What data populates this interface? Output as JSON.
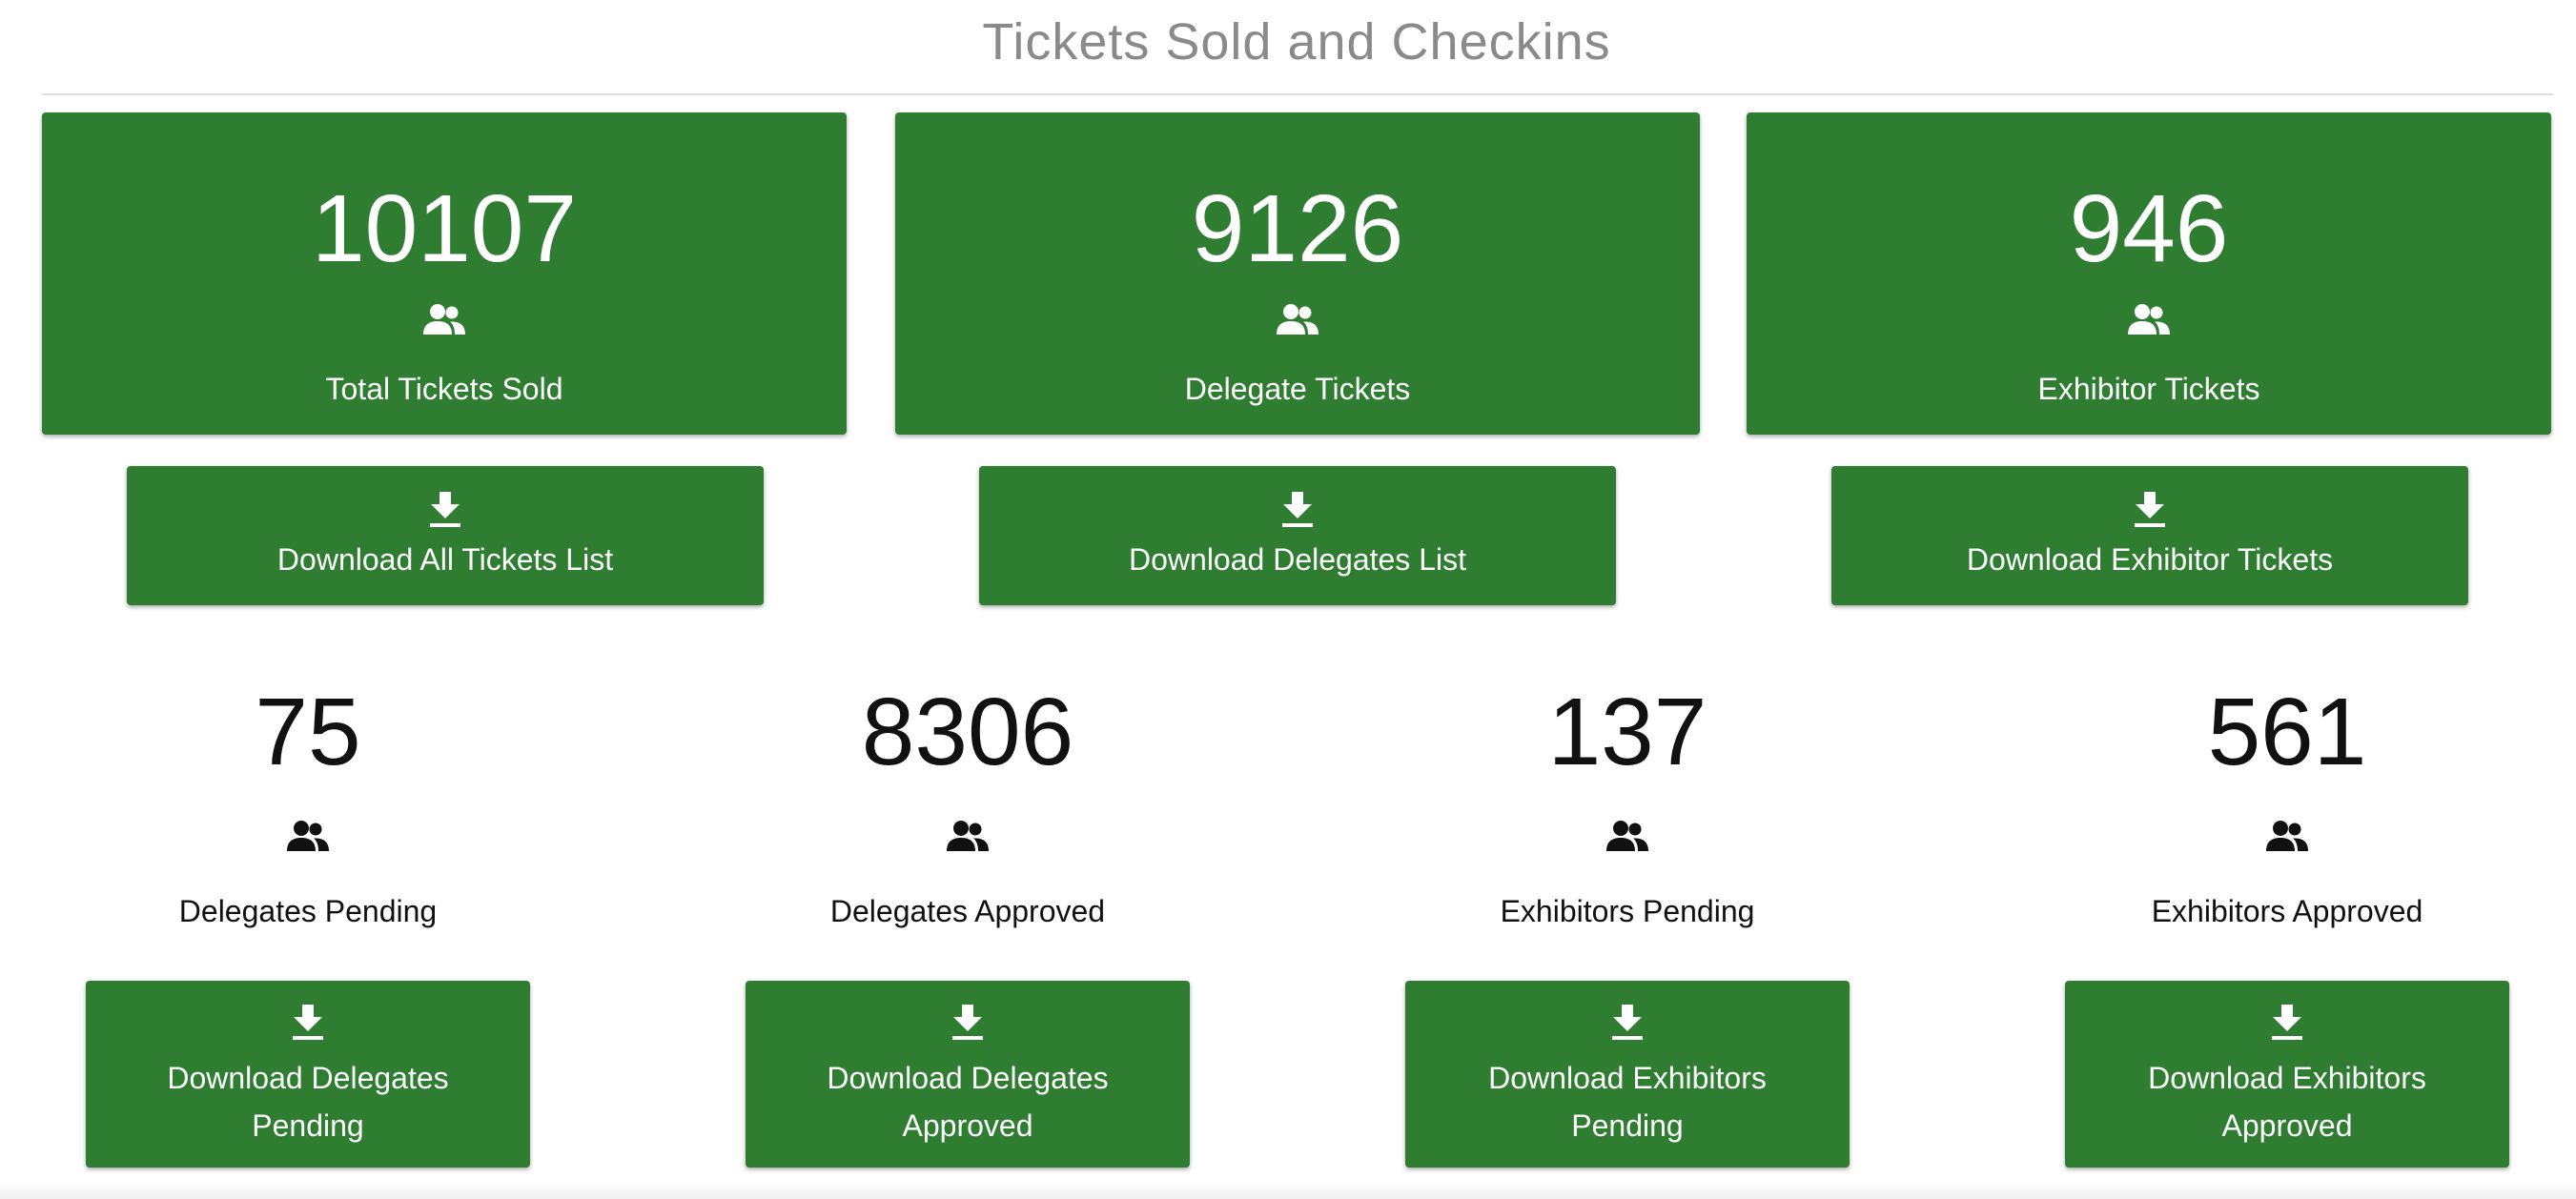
{
  "page": {
    "title": "Tickets Sold and Checkins"
  },
  "colors": {
    "card_green": "#2e7d31",
    "title_gray": "#8a8a8a",
    "text_dark": "#111111"
  },
  "icons": {
    "people": "people-icon",
    "download": "download-icon"
  },
  "stat_cards": [
    {
      "value": "10107",
      "label": "Total Tickets Sold"
    },
    {
      "value": "9126",
      "label": "Delegate Tickets"
    },
    {
      "value": "946",
      "label": "Exhibitor Tickets"
    }
  ],
  "top_downloads": [
    {
      "label": "Download All Tickets List"
    },
    {
      "label": "Download Delegates List"
    },
    {
      "label": "Download Exhibitor Tickets"
    }
  ],
  "sub_stats": [
    {
      "value": "75",
      "label": "Delegates Pending"
    },
    {
      "value": "8306",
      "label": "Delegates Approved"
    },
    {
      "value": "137",
      "label": "Exhibitors Pending"
    },
    {
      "value": "561",
      "label": "Exhibitors Approved"
    }
  ],
  "bottom_downloads": [
    {
      "line1": "Download Delegates",
      "line2": "Pending"
    },
    {
      "line1": "Download Delegates",
      "line2": "Approved"
    },
    {
      "line1": "Download Exhibitors",
      "line2": "Pending"
    },
    {
      "line1": "Download Exhibitors",
      "line2": "Approved"
    }
  ]
}
